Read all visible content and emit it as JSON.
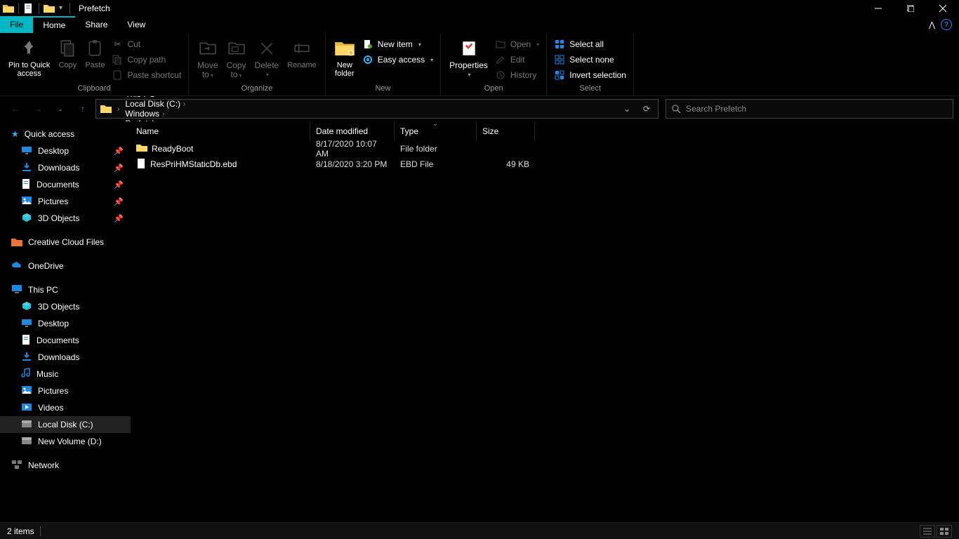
{
  "window": {
    "title": "Prefetch"
  },
  "tabs": {
    "file": "File",
    "home": "Home",
    "share": "Share",
    "view": "View"
  },
  "ribbon": {
    "pin": "Pin to Quick\naccess",
    "copy": "Copy",
    "paste": "Paste",
    "cut": "Cut",
    "copy_path": "Copy path",
    "paste_shortcut": "Paste shortcut",
    "clipboard": "Clipboard",
    "move_to": "Move\nto",
    "copy_to": "Copy\nto",
    "delete": "Delete",
    "rename": "Rename",
    "organize": "Organize",
    "new_folder": "New\nfolder",
    "new_item": "New item",
    "easy_access": "Easy access",
    "new": "New",
    "properties": "Properties",
    "open": "Open",
    "edit": "Edit",
    "history": "History",
    "open_group": "Open",
    "select_all": "Select all",
    "select_none": "Select none",
    "invert_selection": "Invert selection",
    "select": "Select"
  },
  "breadcrumb": [
    "This PC",
    "Local Disk (C:)",
    "Windows",
    "Prefetch"
  ],
  "search_placeholder": "Search Prefetch",
  "columns": {
    "name": "Name",
    "date": "Date modified",
    "type": "Type",
    "size": "Size"
  },
  "files": [
    {
      "name": "ReadyBoot",
      "date": "8/17/2020 10:07 AM",
      "type": "File folder",
      "size": "",
      "icon": "folder"
    },
    {
      "name": "ResPriHMStaticDb.ebd",
      "date": "8/18/2020 3:20 PM",
      "type": "EBD File",
      "size": "49 KB",
      "icon": "file"
    }
  ],
  "tree": {
    "quick_access": "Quick access",
    "qa_items": [
      {
        "label": "Desktop",
        "icon": "desktop",
        "pinned": true
      },
      {
        "label": "Downloads",
        "icon": "downloads",
        "pinned": true
      },
      {
        "label": "Documents",
        "icon": "documents",
        "pinned": true
      },
      {
        "label": "Pictures",
        "icon": "pictures",
        "pinned": true
      },
      {
        "label": "3D Objects",
        "icon": "3d",
        "pinned": true
      }
    ],
    "creative_cloud": "Creative Cloud Files",
    "onedrive": "OneDrive",
    "this_pc": "This PC",
    "pc_items": [
      {
        "label": "3D Objects",
        "icon": "3d"
      },
      {
        "label": "Desktop",
        "icon": "desktop"
      },
      {
        "label": "Documents",
        "icon": "documents"
      },
      {
        "label": "Downloads",
        "icon": "downloads"
      },
      {
        "label": "Music",
        "icon": "music"
      },
      {
        "label": "Pictures",
        "icon": "pictures"
      },
      {
        "label": "Videos",
        "icon": "videos"
      },
      {
        "label": "Local Disk (C:)",
        "icon": "drive",
        "selected": true
      },
      {
        "label": "New Volume (D:)",
        "icon": "drive"
      }
    ],
    "network": "Network"
  },
  "status": {
    "items": "2 items"
  }
}
